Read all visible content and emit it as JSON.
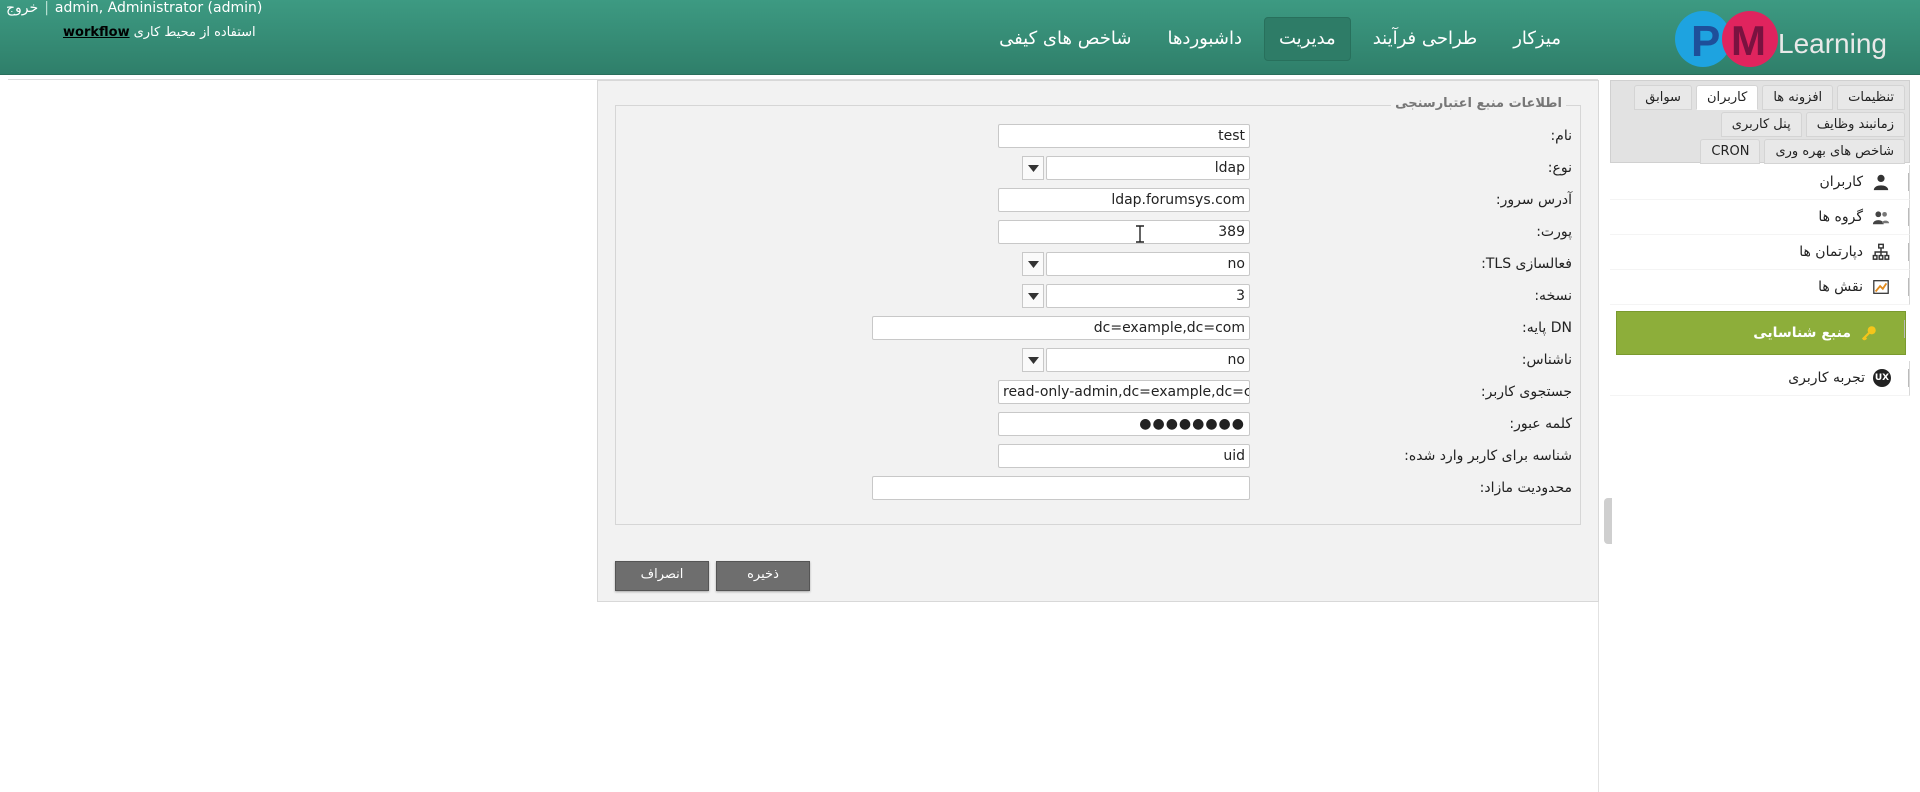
{
  "header": {
    "logo_text": "PMLearning",
    "logo_letters": "PM",
    "logo_word": "Learning",
    "nav": [
      {
        "label": "میزکار",
        "active": false
      },
      {
        "label": "طراحی فرآیند",
        "active": false
      },
      {
        "label": "مدیریت",
        "active": true
      },
      {
        "label": "داشبوردها",
        "active": false
      },
      {
        "label": "شاخص های کیفی",
        "active": false
      }
    ],
    "user": "admin, Administrator (admin)",
    "logout": "خروج",
    "workspace_prefix": "استفاده از محیط کاری",
    "workspace_link": "workflow"
  },
  "sidebar": {
    "tab_rows": [
      [
        {
          "label": "تنظیمات"
        },
        {
          "label": "افزونه ها"
        },
        {
          "label": "کاربران",
          "active": true
        },
        {
          "label": "سوابق"
        }
      ],
      [
        {
          "label": "زمانبند وظایف"
        },
        {
          "label": "پنل کاربری"
        }
      ],
      [
        {
          "label": "شاخص های بهره وری"
        },
        {
          "label": "CRON"
        }
      ]
    ],
    "menu": [
      {
        "label": "کاربران",
        "icon": "user-icon"
      },
      {
        "label": "گروه ها",
        "icon": "group-icon"
      },
      {
        "label": "دپارتمان ها",
        "icon": "department-icon"
      },
      {
        "label": "نقش ها",
        "icon": "roles-icon"
      },
      {
        "label": "منبع شناسایی",
        "icon": "key-icon",
        "active": true
      },
      {
        "label": "تجربه کاربری",
        "icon": "ux-icon",
        "icon_text": "UX"
      }
    ]
  },
  "form": {
    "legend": "اطلاعات منبع اعتبارسنجی",
    "fields": {
      "name": {
        "label": "نام:",
        "value": "test"
      },
      "type": {
        "label": "نوع:",
        "value": "ldap"
      },
      "server": {
        "label": "آدرس سرور:",
        "value": "ldap.forumsys.com"
      },
      "port": {
        "label": "پورت:",
        "value": "389"
      },
      "tls": {
        "label": "فعالسازی TLS:",
        "value": "no"
      },
      "version": {
        "label": "نسخه:",
        "value": "3"
      },
      "base_dn": {
        "label": "DN پایه:",
        "value": "dc=example,dc=com"
      },
      "anonymous": {
        "label": "ناشناس:",
        "value": "no"
      },
      "user_search": {
        "label": "جستجوی کاربر:",
        "value": "read-only-admin,dc=example,dc=com"
      },
      "password": {
        "label": "کلمه عبور:",
        "value": "●●●●●●●●"
      },
      "login_id": {
        "label": "شناسه برای کاربر وارد شده:",
        "value": "uid"
      },
      "extra_limit": {
        "label": "محدودیت مازاد:",
        "value": ""
      }
    },
    "save_label": "ذخیره",
    "cancel_label": "انصراف"
  }
}
